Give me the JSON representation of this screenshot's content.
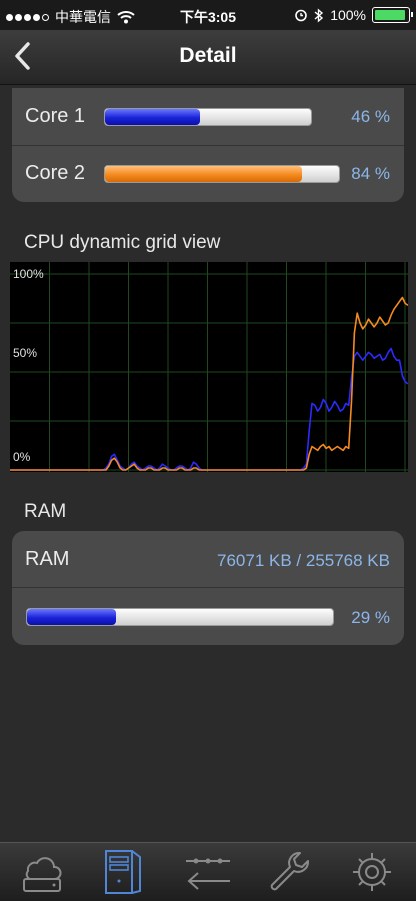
{
  "status_bar": {
    "carrier": "中華電信",
    "time": "下午3:05",
    "battery": "100%"
  },
  "nav": {
    "title": "Detail",
    "back_icon": "chevron-left-icon"
  },
  "cores": [
    {
      "label": "Core 1",
      "percent_text": "46 %",
      "value": 46,
      "color": "#1a22d8"
    },
    {
      "label": "Core 2",
      "percent_text": "84 %",
      "value": 84,
      "color": "#f58a1f"
    }
  ],
  "cpu_section": {
    "title": "CPU dynamic grid view"
  },
  "chart_data": {
    "type": "line",
    "title": "",
    "xlabel": "",
    "ylabel": "",
    "ylim": [
      0,
      100
    ],
    "y_ticks": [
      "100%",
      "50%",
      "0%"
    ],
    "grid": true,
    "series": [
      {
        "color": "#2b2bff",
        "values": [
          0,
          0,
          0,
          0,
          0,
          0,
          0,
          0,
          0,
          0,
          0,
          0,
          0,
          0,
          0,
          0,
          0,
          0,
          0,
          0,
          0,
          0,
          0,
          0,
          0,
          0,
          0,
          0,
          0,
          0,
          0,
          0,
          0,
          0,
          1,
          3,
          7,
          8,
          5,
          2,
          1,
          0,
          1,
          3,
          4,
          2,
          1,
          0,
          1,
          2,
          2,
          1,
          0,
          1,
          3,
          2,
          1,
          0,
          0,
          1,
          2,
          2,
          1,
          0,
          1,
          4,
          3,
          1,
          0,
          0,
          0,
          0,
          0,
          0,
          0,
          0,
          0,
          0,
          0,
          0,
          0,
          0,
          0,
          0,
          0,
          0,
          0,
          0,
          0,
          0,
          0,
          0,
          0,
          0,
          0,
          0,
          0,
          0,
          0,
          0,
          0,
          0,
          0,
          0,
          1,
          3,
          20,
          34,
          33,
          30,
          32,
          36,
          34,
          30,
          32,
          35,
          33,
          30,
          31,
          34,
          33,
          47,
          58,
          60,
          58,
          56,
          58,
          60,
          59,
          57,
          58,
          59,
          56,
          57,
          60,
          62,
          58,
          56,
          56,
          48,
          45,
          44
        ]
      },
      {
        "color": "#f58a1f",
        "values": [
          0,
          0,
          0,
          0,
          0,
          0,
          0,
          0,
          0,
          0,
          0,
          0,
          0,
          0,
          0,
          0,
          0,
          0,
          0,
          0,
          0,
          0,
          0,
          0,
          0,
          0,
          0,
          0,
          0,
          0,
          0,
          0,
          0,
          0,
          0,
          2,
          5,
          6,
          4,
          1,
          0,
          0,
          1,
          2,
          3,
          1,
          0,
          0,
          0,
          1,
          1,
          0,
          0,
          0,
          1,
          1,
          0,
          0,
          0,
          0,
          1,
          1,
          0,
          0,
          0,
          1,
          1,
          0,
          0,
          0,
          0,
          0,
          0,
          0,
          0,
          0,
          0,
          0,
          0,
          0,
          0,
          0,
          0,
          0,
          0,
          0,
          0,
          0,
          0,
          0,
          0,
          0,
          0,
          0,
          0,
          0,
          0,
          0,
          0,
          0,
          0,
          0,
          0,
          0,
          0,
          1,
          8,
          12,
          11,
          10,
          12,
          13,
          11,
          12,
          10,
          11,
          12,
          11,
          10,
          12,
          11,
          35,
          70,
          80,
          75,
          72,
          74,
          77,
          75,
          73,
          75,
          78,
          76,
          74,
          75,
          79,
          82,
          84,
          86,
          88,
          85,
          84
        ]
      }
    ]
  },
  "ram_section": {
    "title": "RAM",
    "label": "RAM",
    "value_text": "76071 KB / 255768 KB",
    "percent_text": "29 %",
    "value": 29
  },
  "tabbar": {
    "icons": [
      "cloud-drive-icon",
      "computer-tower-icon",
      "transfer-arrows-icon",
      "wrench-icon",
      "gear-icon"
    ],
    "active": 1
  }
}
